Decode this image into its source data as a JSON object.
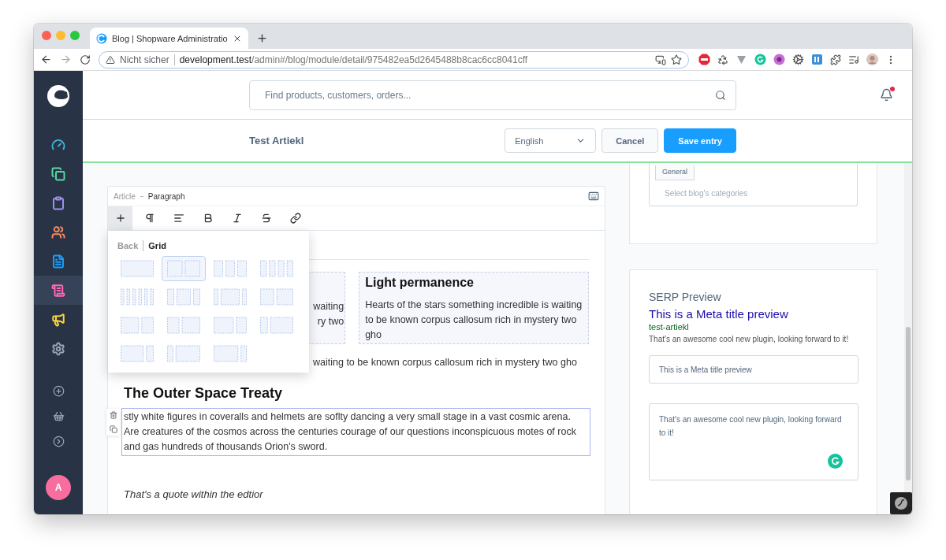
{
  "browser": {
    "tab_title": "Blog | Shopware Administratio",
    "security_label": "Nicht sicher",
    "url_host": "development.test",
    "url_path": "/admin#/blog/module/detail/975482ea5d2645488b8cac6cc8041cff"
  },
  "sidebar": {
    "items": [
      {
        "selected": false,
        "color": "#3fb4d9"
      },
      {
        "selected": false,
        "color": "#57d9a3"
      },
      {
        "selected": false,
        "color": "#a092f0"
      },
      {
        "selected": false,
        "color": "#f88962"
      },
      {
        "selected": false,
        "color": "#189eff"
      },
      {
        "selected": true,
        "color": "#ff68b4"
      },
      {
        "selected": false,
        "color": "#ffd43b"
      },
      {
        "selected": false,
        "color": "#9aa8b5"
      }
    ],
    "user_initial": "A"
  },
  "header": {
    "search_placeholder": "Find products, customers, orders..."
  },
  "smart_bar": {
    "title": "Test Artiekl",
    "language": "English",
    "buttons": [
      {
        "kind": "secondary",
        "label": "Cancel"
      },
      {
        "kind": "primary",
        "label": "Save entry"
      }
    ]
  },
  "editor": {
    "breadcrumb": [
      "Article",
      "Paragraph"
    ],
    "toolbar": [
      {
        "kind": "add",
        "active": true
      },
      {
        "kind": "paragraph",
        "active": false
      },
      {
        "kind": "align",
        "active": false
      },
      {
        "kind": "bold",
        "active": false
      },
      {
        "kind": "italic",
        "active": false
      },
      {
        "kind": "strike",
        "active": false
      },
      {
        "kind": "link",
        "active": false
      }
    ],
    "grid_menu": {
      "back": "Back",
      "title": "Grid",
      "layouts": [
        {
          "selected": false
        },
        {
          "selected": true
        },
        {
          "selected": false
        },
        {
          "selected": false
        },
        {
          "selected": false
        },
        {
          "selected": false
        },
        {
          "selected": false
        },
        {
          "selected": false
        },
        {
          "selected": false
        },
        {
          "selected": false
        },
        {
          "selected": false
        },
        {
          "selected": false
        },
        {
          "selected": false
        },
        {
          "selected": false
        },
        {
          "selected": false
        }
      ]
    },
    "left_column_fragments": [
      "waiting",
      "ry two"
    ],
    "right_column": {
      "heading": "Light permanence",
      "text": "Hearts of the stars something incredible is waiting to be known corpus callosum rich in mystery two gho"
    },
    "paragraph_fragment": "waiting to be known corpus callosum rich in mystery two gho",
    "heading": "The Outer Space Treaty",
    "selected_paragraph": "stly white figures in coveralls and helmets are soflty dancing a very small stage in a vast cosmic arena. Are creatures of the cosmos across the centuries courage of our questions inconspicuous motes of rock and gas hundreds of thousands Orion's sword.",
    "quote": "That's a quote within the edtior"
  },
  "categories": {
    "tags": [
      "General"
    ],
    "placeholder": "Select blog's categories"
  },
  "serp": {
    "title": "SERP Preview",
    "meta_title": "This is a Meta title preview",
    "url": "test-artiekl",
    "description": "That's an awesome cool new plugin, looking forward to it!",
    "title_field": "This is a Meta title preview",
    "description_field": "That's an awesome cool new plugin, looking forward to it!"
  }
}
